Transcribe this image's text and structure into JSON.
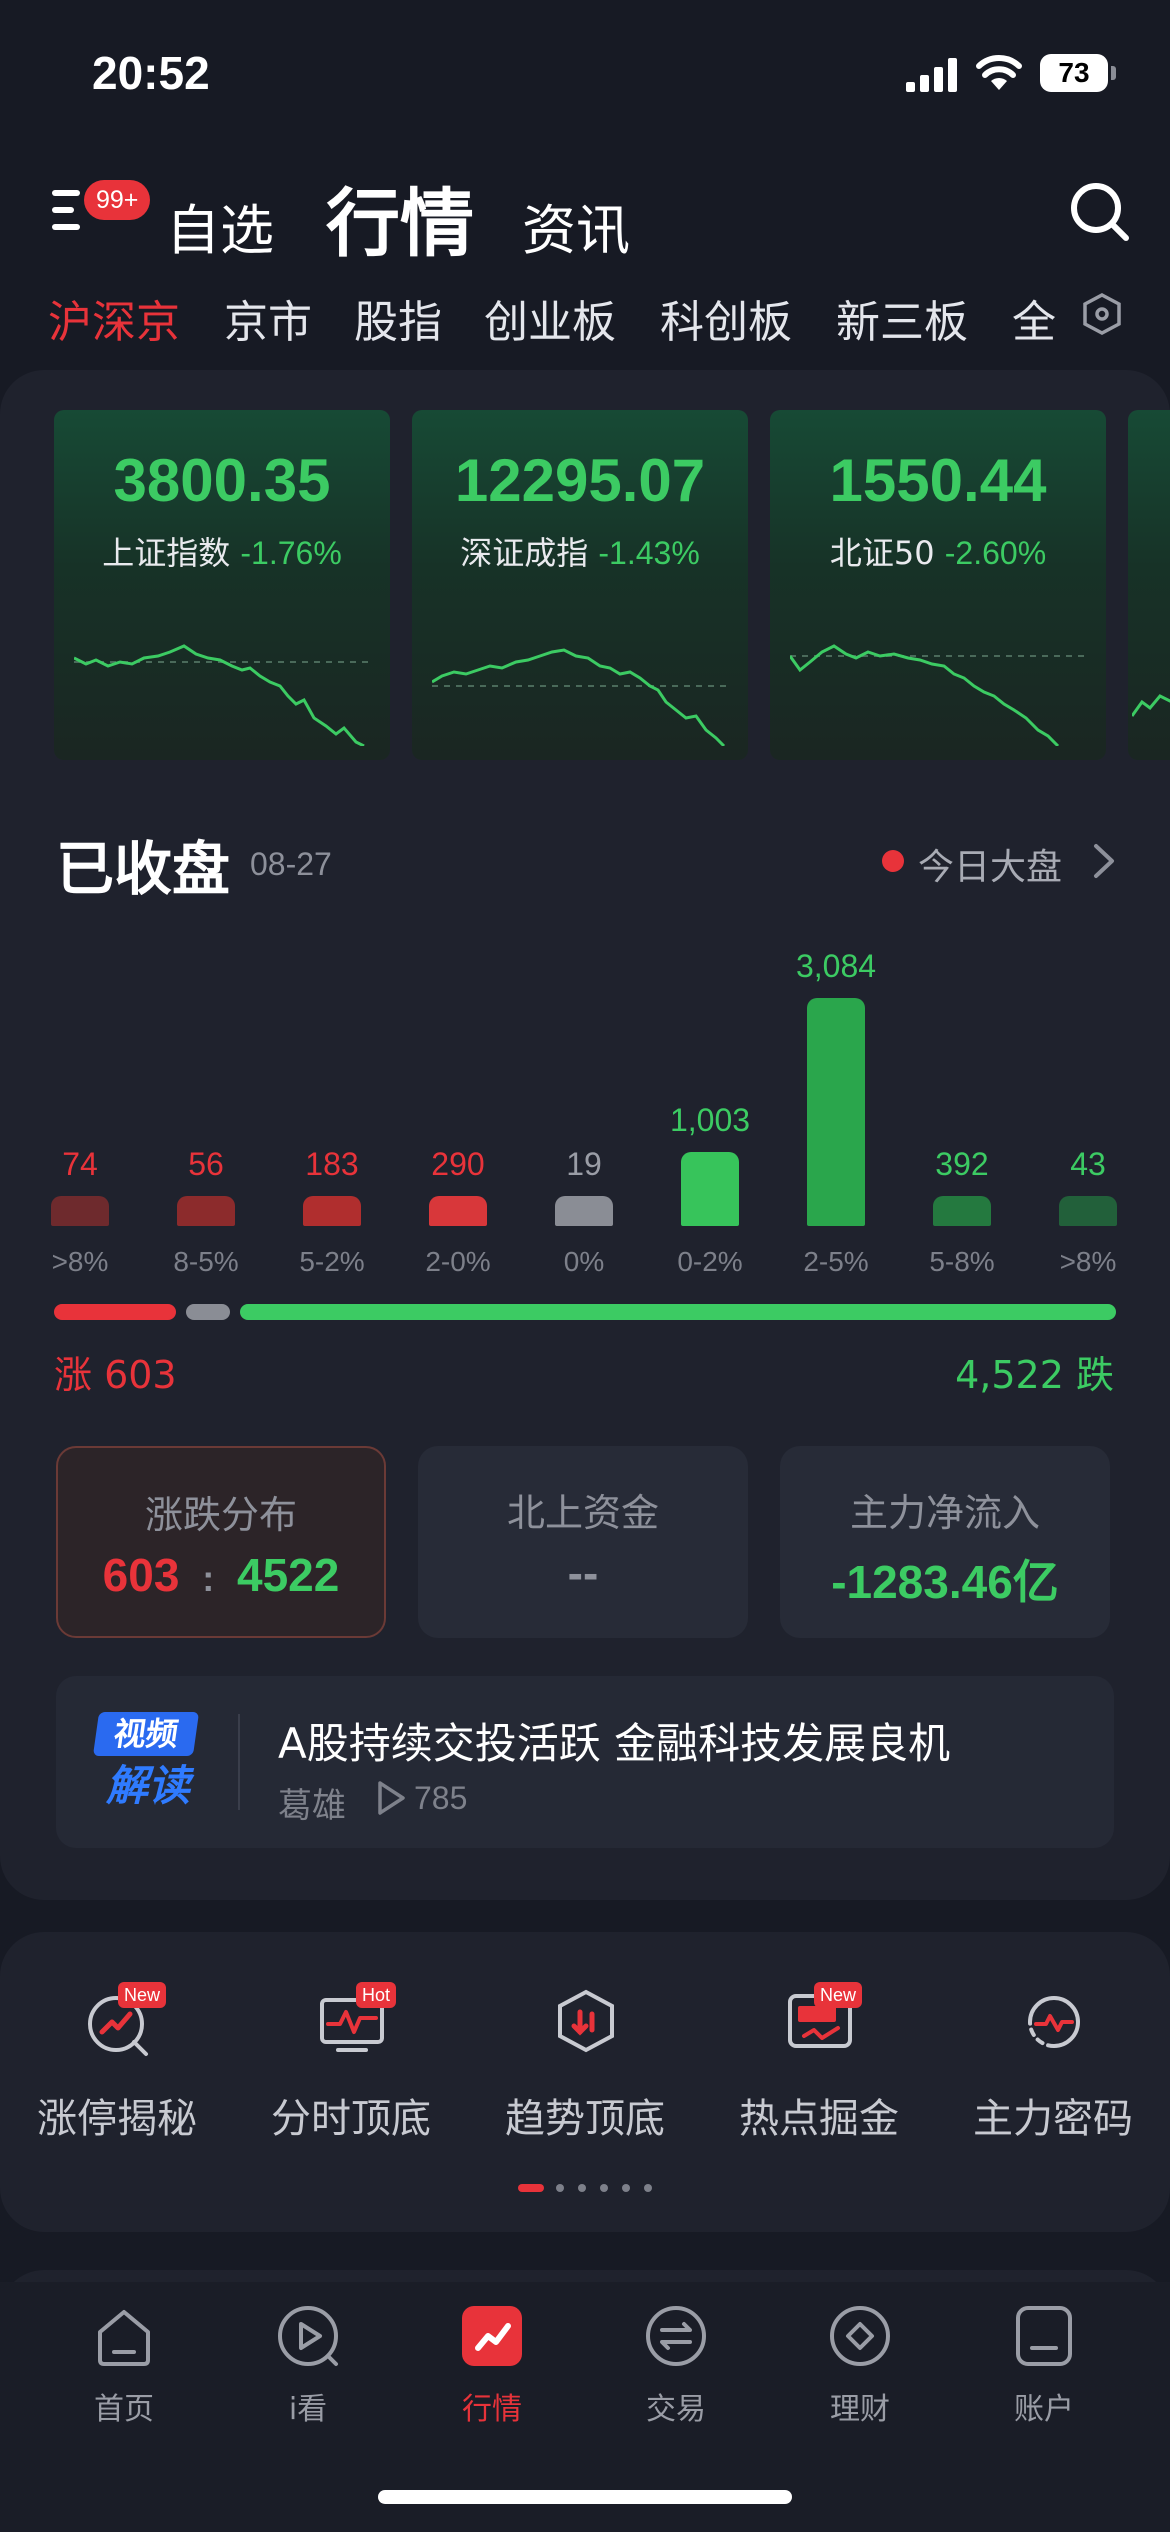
{
  "status": {
    "time": "20:52",
    "battery": "73"
  },
  "nav": {
    "badge": "99+",
    "tabs": [
      "自选",
      "行情",
      "资讯"
    ]
  },
  "market_tabs": [
    "沪深京",
    "京市",
    "股指",
    "创业板",
    "科创板",
    "新三板",
    "全"
  ],
  "indices": [
    {
      "value": "3800.35",
      "name": "上证指数",
      "change": "-1.76%"
    },
    {
      "value": "12295.07",
      "name": "深证成指",
      "change": "-1.43%"
    },
    {
      "value": "1550.44",
      "name": "北证50",
      "change": "-2.60%"
    }
  ],
  "session": {
    "title": "已收盘",
    "date": "08-27",
    "today_label": "今日大盘"
  },
  "chart_data": {
    "type": "bar",
    "categories": [
      ">8%",
      "8-5%",
      "5-2%",
      "2-0%",
      "0%",
      "0-2%",
      "2-5%",
      "5-8%",
      ">8%"
    ],
    "values": [
      74,
      56,
      183,
      290,
      19,
      1003,
      3084,
      392,
      43
    ],
    "value_labels": [
      "74",
      "56",
      "183",
      "290",
      "19",
      "1,003",
      "3,084",
      "392",
      "43"
    ],
    "colors": [
      "#6e2a2d",
      "#8c2b2c",
      "#b02e2e",
      "#d8373a",
      "#8a8d95",
      "#37c45b",
      "#2aa64c",
      "#24793f",
      "#22603a"
    ],
    "label_colors": [
      "#e8333a",
      "#e8333a",
      "#e8333a",
      "#e8333a",
      "#9a9da6",
      "#3ccb63",
      "#3ccb63",
      "#3ccb63",
      "#3ccb63"
    ]
  },
  "ratio": {
    "up": 603,
    "flat": 19,
    "down": 4522,
    "up_label": "涨 603",
    "down_label": "4,522 跌"
  },
  "stats": [
    {
      "title": "涨跌分布",
      "up": "603",
      "sep": ":",
      "down": "4522"
    },
    {
      "title": "北上资金",
      "value": "--"
    },
    {
      "title": "主力净流入",
      "value": "-1283.46亿"
    }
  ],
  "video": {
    "logo_top": "视频",
    "logo_bottom": "解读",
    "title": "A股持续交投活跃 金融科技发展良机",
    "author": "葛雄",
    "plays": "785"
  },
  "tools": [
    {
      "label": "涨停揭秘",
      "badge": "New",
      "icon": "limit-up-icon"
    },
    {
      "label": "分时顶底",
      "badge": "Hot",
      "icon": "intraday-icon"
    },
    {
      "label": "趋势顶底",
      "badge": "",
      "icon": "trend-icon"
    },
    {
      "label": "热点掘金",
      "badge": "New",
      "icon": "hot-spot-icon"
    },
    {
      "label": "主力密码",
      "badge": "",
      "icon": "main-force-icon"
    }
  ],
  "bottom_nav": [
    "首页",
    "i看",
    "行情",
    "交易",
    "理财",
    "账户"
  ],
  "colors": {
    "red": "#e8333a",
    "green": "#3ccb63",
    "bg": "#171a24",
    "card": "#1f222d"
  }
}
